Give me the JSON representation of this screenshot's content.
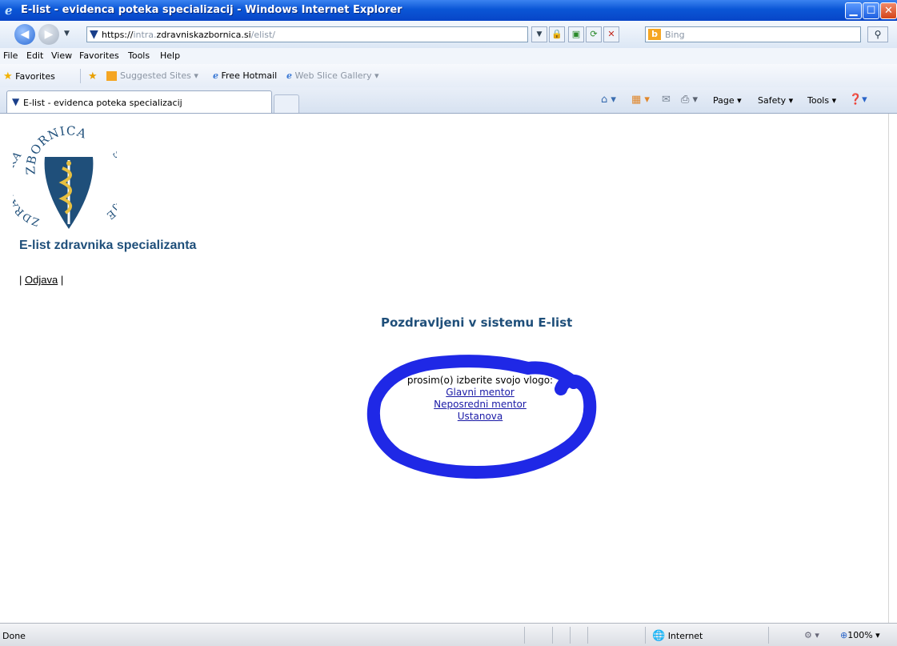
{
  "window": {
    "title": "E-list - evidenca poteka specializacij - Windows Internet Explorer",
    "minimize_glyph": "▁",
    "maximize_glyph": "☐",
    "close_glyph": "✕"
  },
  "address_bar": {
    "url_prefix": "https://",
    "url_host_dim_1": "intra.",
    "url_host": "zdravniskazbornica.si",
    "url_path": "/elist/"
  },
  "search": {
    "placeholder": "Bing",
    "engine_letter": "b"
  },
  "menu": [
    "File",
    "Edit",
    "View",
    "Favorites",
    "Tools",
    "Help"
  ],
  "favorites_bar": {
    "favorites_label": "Favorites",
    "items": [
      "Suggested Sites ▾",
      "Free Hotmail",
      "Web Slice Gallery ▾"
    ]
  },
  "tab": {
    "label": "E-list - evidenca poteka specializacij"
  },
  "command_bar": {
    "page": "Page ▾",
    "safety": "Safety ▾",
    "tools": "Tools ▾"
  },
  "page": {
    "logo_text_top": "ZBORNICA",
    "logo_text_left": "ZDRAVNIŠKA",
    "logo_text_right": "SLOVENIJE",
    "app_title": "E-list zdravnika specializanta",
    "logout_prefix": "| ",
    "logout_label": "Odjava",
    "logout_suffix": " |",
    "welcome": "Pozdravljeni v sistemu E-list",
    "role_prompt": "prosim(o) izberite svojo vlogo:",
    "roles": [
      "Glavni mentor",
      "Neposredni mentor",
      "Ustanova"
    ]
  },
  "status_bar": {
    "status": "Done",
    "zone": "Internet",
    "zoom": "100%"
  },
  "colors": {
    "title_blue": "#1f4f7a",
    "marker_blue": "#1f28e6",
    "link": "#1a1aa6"
  }
}
